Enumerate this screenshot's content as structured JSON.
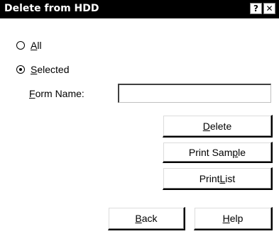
{
  "titlebar": {
    "title": "Delete from HDD",
    "help_glyph": "?",
    "close_glyph": "✕"
  },
  "radios": {
    "all": {
      "mnemonic": "A",
      "rest": "ll",
      "selected": false
    },
    "selected": {
      "mnemonic": "S",
      "rest": "elected",
      "selected": true
    }
  },
  "form_name": {
    "label_mnemonic": "F",
    "label_rest": "orm Name:",
    "value": ""
  },
  "buttons": {
    "delete": {
      "mnemonic": "D",
      "rest": "elete"
    },
    "print_sample": {
      "pre": "Print Sam",
      "mnemonic": "p",
      "rest": "le"
    },
    "print_list": {
      "pre": "Print ",
      "mnemonic": "L",
      "rest": "ist"
    },
    "back": {
      "mnemonic": "B",
      "rest": "ack"
    },
    "help": {
      "mnemonic": "H",
      "rest": "elp"
    }
  }
}
